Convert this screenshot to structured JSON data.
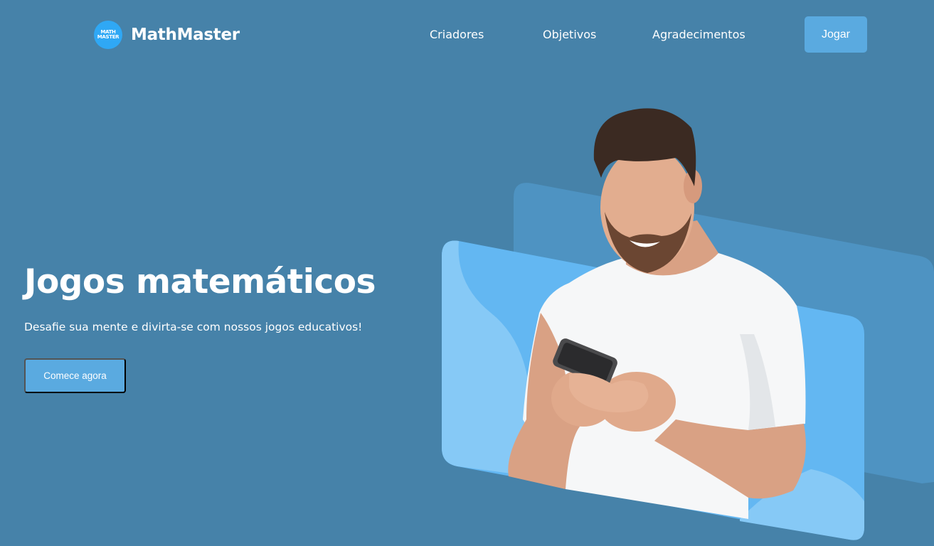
{
  "header": {
    "logo_badge_lines": [
      "MATH",
      "MASTER"
    ],
    "brand_name": "MathMaster",
    "nav": [
      {
        "label": "Criadores"
      },
      {
        "label": "Objetivos"
      },
      {
        "label": "Agradecimentos"
      }
    ],
    "play_label": "Jogar"
  },
  "hero": {
    "title": "Jogos matemáticos",
    "subtitle": "Desafie sua mente e divirta-se com nossos jogos educativos!",
    "cta_label": "Comece agora",
    "image_subject": "smiling man holding smartphone"
  },
  "colors": {
    "background": "#4682a9",
    "button": "#5aaae0",
    "logo_badge": "#2fa8f5",
    "card_back": "#4e93c2",
    "card_front": "#63b7f2",
    "card_wave": "#86c9f6"
  }
}
